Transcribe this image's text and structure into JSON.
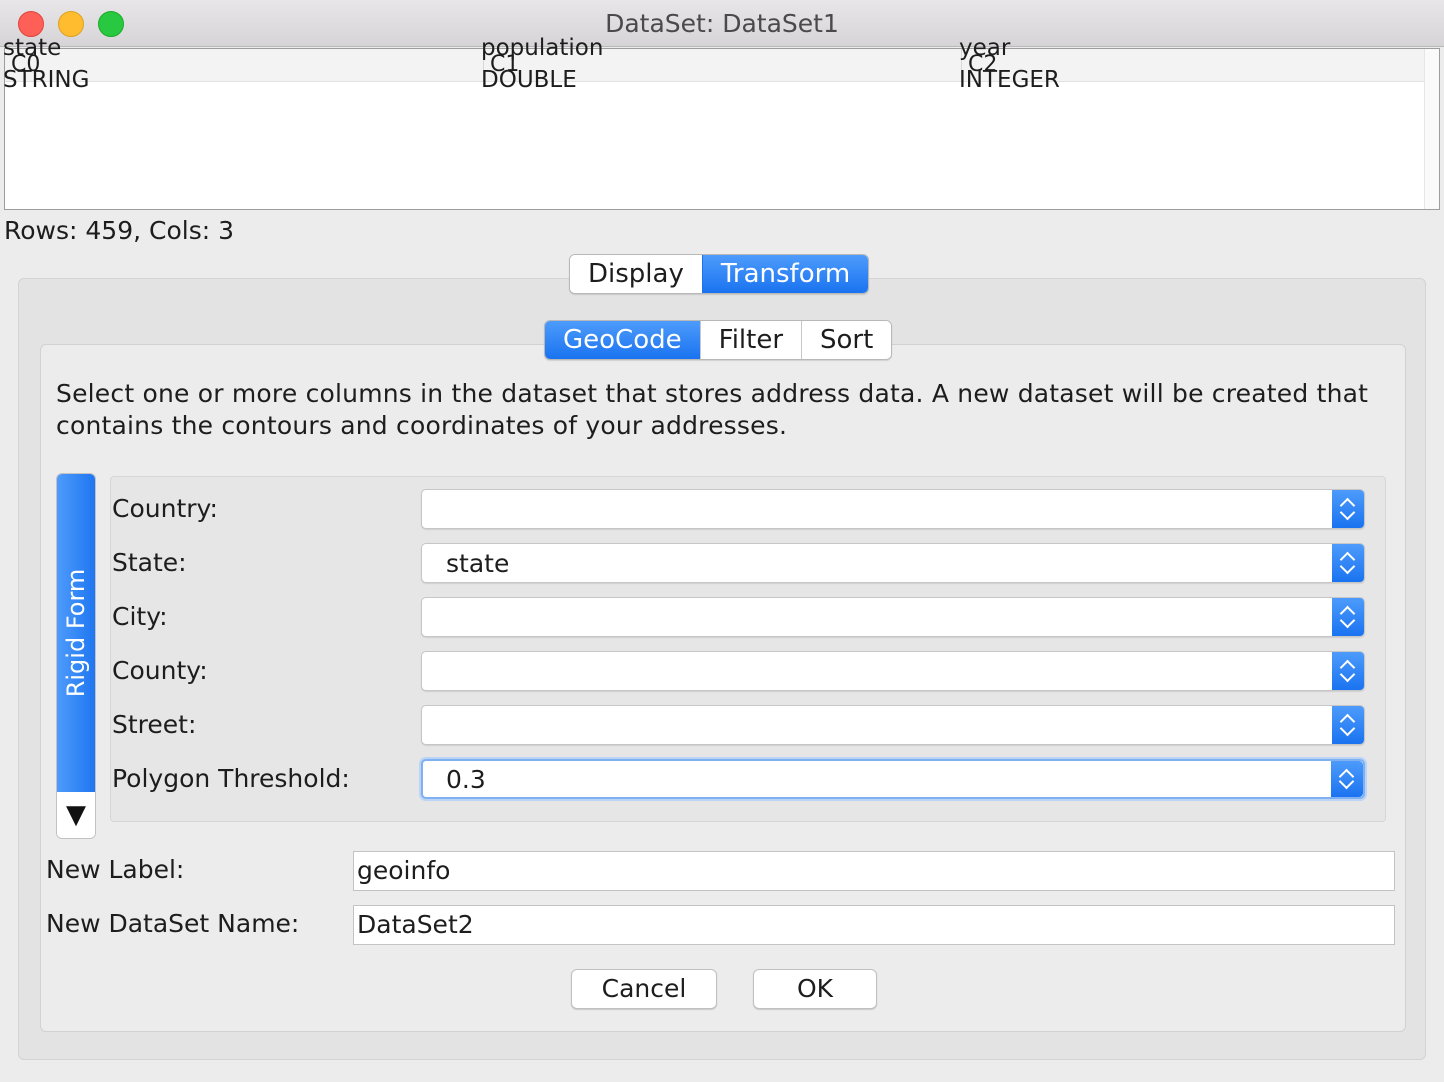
{
  "window": {
    "title": "DataSet: DataSet1"
  },
  "table": {
    "columns": [
      "C0",
      "C1",
      "C2"
    ],
    "rows": [
      [
        "state",
        "population",
        "year"
      ],
      [
        "STRING",
        "DOUBLE",
        "INTEGER"
      ]
    ],
    "rows_cols_text": "Rows: 459, Cols: 3"
  },
  "main_tabs": {
    "display": "Display",
    "transform": "Transform",
    "active": "Transform"
  },
  "sub_tabs": {
    "geocode": "GeoCode",
    "filter": "Filter",
    "sort": "Sort",
    "active": "GeoCode"
  },
  "geocode": {
    "description": "Select one or more columns in the dataset that stores address data. A new dataset will be created that contains the contours and coordinates of your addresses.",
    "side_tab_label": "Rigid Form",
    "side_tab_arrow": "▼",
    "fields": [
      {
        "label": "Country:",
        "value": ""
      },
      {
        "label": "State:",
        "value": "state"
      },
      {
        "label": "City:",
        "value": ""
      },
      {
        "label": "County:",
        "value": ""
      },
      {
        "label": "Street:",
        "value": ""
      },
      {
        "label": "Polygon Threshold:",
        "value": "0.3"
      }
    ],
    "new_label": {
      "label": "New Label:",
      "value": "geoinfo"
    },
    "new_dataset_name": {
      "label": "New DataSet Name:",
      "value": "DataSet2"
    }
  },
  "buttons": {
    "cancel": "Cancel",
    "ok": "OK"
  },
  "colors": {
    "accent": "#1a73f0",
    "close": "#fe5f57",
    "minimize": "#febc2e",
    "maximize": "#28c840"
  }
}
